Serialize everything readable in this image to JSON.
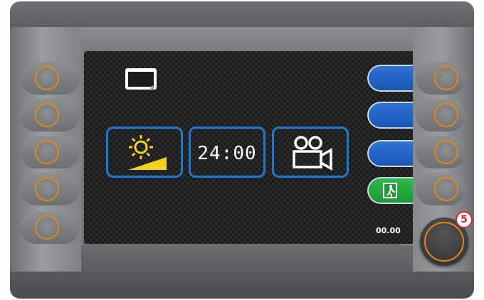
{
  "screen": {
    "clock_format_label": "24:00",
    "time_readout": "00.00"
  },
  "badge": {
    "number": "5"
  },
  "icons": {
    "monitor": "monitor-icon",
    "brightness": "brightness-icon",
    "camera": "video-camera-icon",
    "exit": "emergency-exit-icon"
  },
  "colors": {
    "accent_blue": "#1f78d1",
    "softkey_blue": "#2d73d6",
    "exit_green": "#30b84a",
    "hardware_ring": "#e08a18",
    "icon_yellow": "#f2d21b",
    "badge_red": "#e0261f"
  }
}
